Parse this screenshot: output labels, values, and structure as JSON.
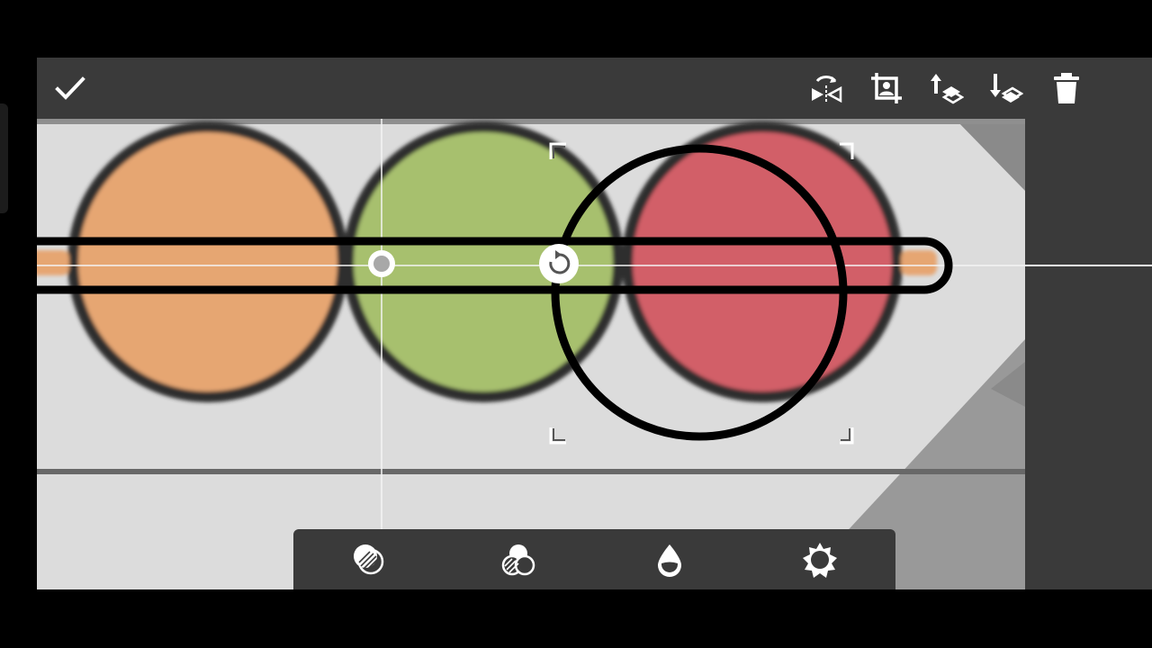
{
  "app": {
    "title": ""
  },
  "toolbar": {
    "confirm_icon": "checkmark-icon",
    "flip_icon": "flip-horizontal-icon",
    "crop_icon": "crop-icon",
    "layer_up_icon": "move-layer-up-icon",
    "layer_down_icon": "move-layer-down-icon",
    "delete_icon": "trash-icon"
  },
  "bottom_tools": [
    {
      "icon": "blend-mode-icon"
    },
    {
      "icon": "color-channels-icon"
    },
    {
      "icon": "opacity-drop-icon"
    },
    {
      "icon": "brightness-gear-icon"
    }
  ],
  "colors": {
    "frame": "#3a3a3a",
    "canvas_bg": "#dcdcdc",
    "light_orange": "#e6a672",
    "light_green": "#a7c06e",
    "light_red": "#d25f67",
    "outline": "#2f2f2f"
  }
}
